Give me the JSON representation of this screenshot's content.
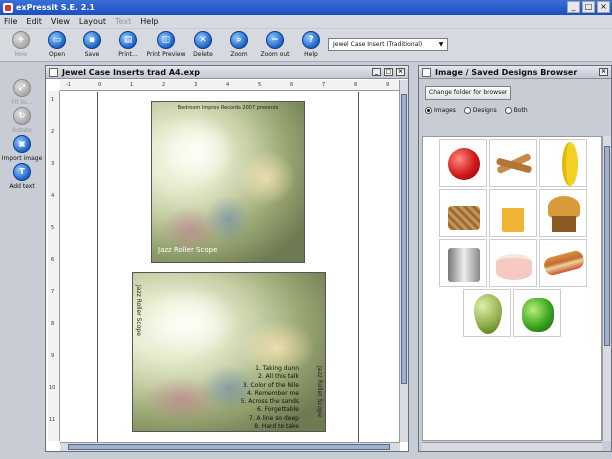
{
  "window": {
    "title": "exPressit S.E. 2.1",
    "controls": [
      "_",
      "□",
      "×"
    ]
  },
  "menu": [
    {
      "label": "File",
      "enabled": true
    },
    {
      "label": "Edit",
      "enabled": true
    },
    {
      "label": "View",
      "enabled": true
    },
    {
      "label": "Layout",
      "enabled": true
    },
    {
      "label": "Text",
      "enabled": false
    },
    {
      "label": "Help",
      "enabled": true
    }
  ],
  "toolbar": {
    "buttons": [
      {
        "label": "New",
        "icon": "new-icon",
        "enabled": false
      },
      {
        "label": "Open",
        "icon": "open-icon",
        "enabled": true
      },
      {
        "label": "Save",
        "icon": "save-icon",
        "enabled": true
      },
      {
        "label": "Print...",
        "icon": "print-icon",
        "enabled": true
      },
      {
        "label": "Print Preview",
        "icon": "print-preview-icon",
        "enabled": true
      },
      {
        "label": "Delete",
        "icon": "delete-icon",
        "enabled": true
      },
      {
        "label": "Zoom",
        "icon": "zoom-icon",
        "enabled": true
      },
      {
        "label": "Zoom out",
        "icon": "zoom-out-icon",
        "enabled": true
      },
      {
        "label": "Help",
        "icon": "help-icon",
        "enabled": true
      }
    ],
    "template_select": "Jewel Case Insert (Traditional)"
  },
  "left_tools": [
    {
      "label": "Fit to...",
      "icon": "fit-icon",
      "enabled": false
    },
    {
      "label": "Rotate",
      "icon": "rotate-icon",
      "enabled": false
    },
    {
      "label": "Import image",
      "icon": "import-image-icon",
      "enabled": true
    },
    {
      "label": "Add text",
      "icon": "add-text-icon",
      "enabled": true
    }
  ],
  "document": {
    "title": "Jewel Case Inserts trad A4.exp",
    "hruler": [
      "-1",
      "0",
      "1",
      "2",
      "3",
      "4",
      "5",
      "6",
      "7",
      "8",
      "9"
    ],
    "vruler": [
      "1",
      "2",
      "3",
      "4",
      "5",
      "6",
      "7",
      "8",
      "9",
      "10",
      "11"
    ],
    "front_top": "Bedroom Improv Records 2007 presents",
    "front_title": "Jazz Roller Scope",
    "spine_left": "Jazz Roller Scope",
    "spine_right": "Jazz Roller Scope",
    "tracks": [
      "1. Taking dunn",
      "2. All this talk",
      "3. Color of the Nile",
      "4. Remember me",
      "5. Across the sands",
      "6. Forgettable",
      "7. A line so deep",
      "8. Hard to take"
    ]
  },
  "browser": {
    "title": "Image / Saved Designs Browser",
    "change_folder": "Change folder for browser",
    "radios": [
      {
        "label": "Images",
        "selected": true
      },
      {
        "label": "Designs",
        "selected": false
      },
      {
        "label": "Both",
        "selected": false
      }
    ],
    "images": [
      "apple",
      "breadsticks",
      "banana",
      "picnic-basket",
      "beer-mug",
      "muffin",
      "toaster",
      "cake",
      "sandwich-roll",
      "grapes",
      "green-pepper"
    ]
  }
}
